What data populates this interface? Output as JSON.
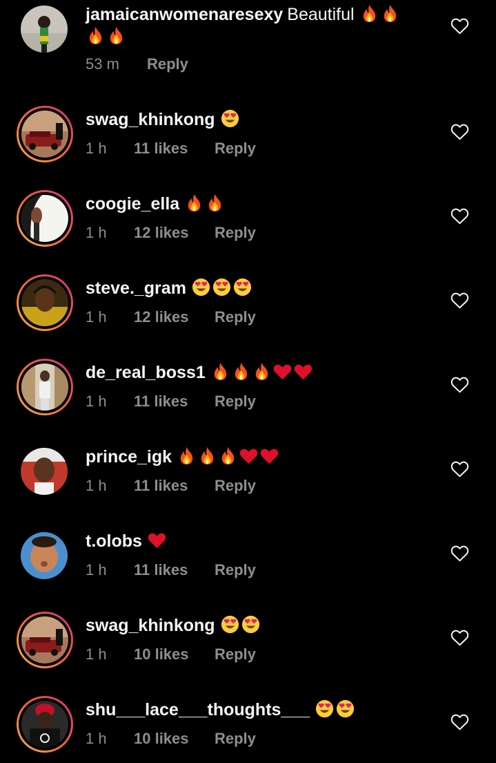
{
  "colors": {
    "background": "#000000",
    "primary_text": "#f5f5f5",
    "secondary_text": "#8e8e8e",
    "story_ring": "#e1306c"
  },
  "comments": [
    {
      "username": "jamaicanwomenaresexy",
      "text": "Beautiful",
      "emoji": [
        "fire-emoji",
        "fire-emoji",
        "fire-emoji",
        "fire-emoji"
      ],
      "time": "53 m",
      "likes": "",
      "reply_label": "Reply",
      "story_ring": false
    },
    {
      "username": "swag_khinkong",
      "text": "",
      "emoji": [
        "heart-eyes-emoji"
      ],
      "time": "1 h",
      "likes": "11 likes",
      "reply_label": "Reply",
      "story_ring": true
    },
    {
      "username": "coogie_ella",
      "text": "",
      "emoji": [
        "fire-emoji",
        "fire-emoji"
      ],
      "time": "1 h",
      "likes": "12 likes",
      "reply_label": "Reply",
      "story_ring": true
    },
    {
      "username": "steve._gram",
      "text": "",
      "emoji": [
        "heart-eyes-emoji",
        "heart-eyes-emoji",
        "heart-eyes-emoji"
      ],
      "time": "1 h",
      "likes": "12 likes",
      "reply_label": "Reply",
      "story_ring": true
    },
    {
      "username": "de_real_boss1",
      "text": "",
      "emoji": [
        "fire-emoji",
        "fire-emoji",
        "fire-emoji",
        "red-heart-emoji",
        "red-heart-emoji"
      ],
      "time": "1 h",
      "likes": "11 likes",
      "reply_label": "Reply",
      "story_ring": true
    },
    {
      "username": "prince_igk",
      "text": "",
      "emoji": [
        "fire-emoji",
        "fire-emoji",
        "fire-emoji",
        "red-heart-emoji",
        "red-heart-emoji"
      ],
      "time": "1 h",
      "likes": "11 likes",
      "reply_label": "Reply",
      "story_ring": false
    },
    {
      "username": "t.olobs",
      "text": "",
      "emoji": [
        "red-heart-emoji"
      ],
      "time": "1 h",
      "likes": "11 likes",
      "reply_label": "Reply",
      "story_ring": false
    },
    {
      "username": "swag_khinkong",
      "text": "",
      "emoji": [
        "heart-eyes-emoji",
        "heart-eyes-emoji"
      ],
      "time": "1 h",
      "likes": "10 likes",
      "reply_label": "Reply",
      "story_ring": true
    },
    {
      "username": "shu___lace___thoughts___",
      "text": "",
      "emoji": [
        "heart-eyes-emoji",
        "heart-eyes-emoji"
      ],
      "time": "1 h",
      "likes": "10 likes",
      "reply_label": "Reply",
      "story_ring": true
    }
  ]
}
